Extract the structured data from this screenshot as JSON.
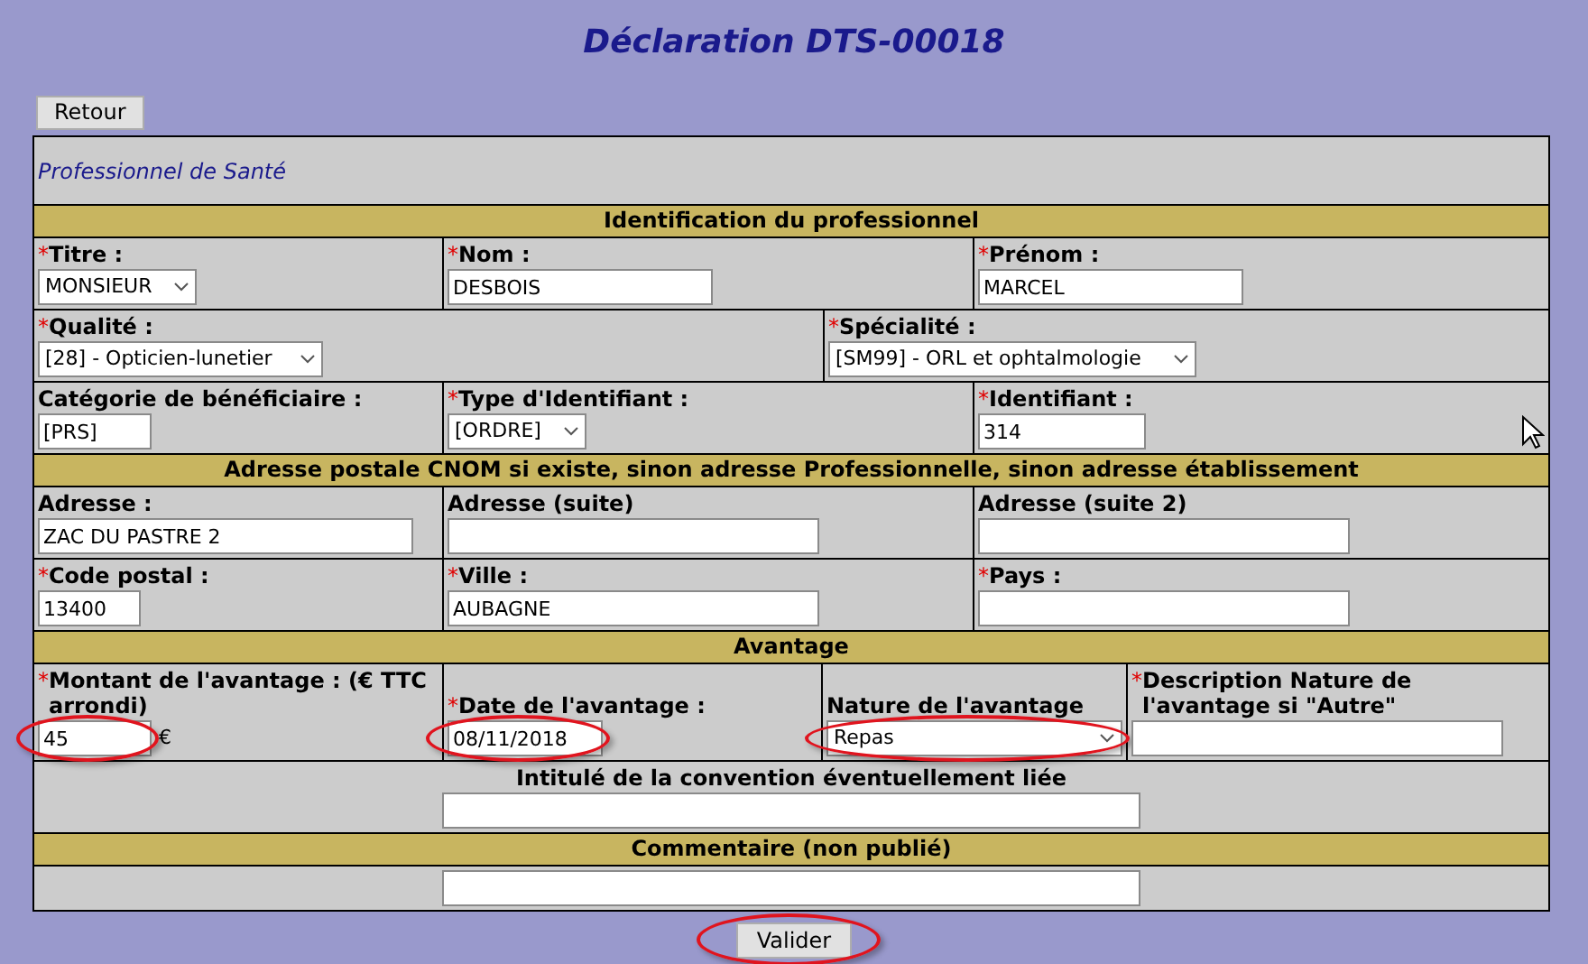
{
  "title": "Déclaration DTS-00018",
  "back_button": {
    "label": "Retour"
  },
  "sections": [
    {
      "kind": "caption",
      "label": "Professionnel de Santé"
    },
    {
      "kind": "header",
      "label": "Identification du professionnel"
    },
    {
      "kind": "fields",
      "fields": [
        {
          "required_mark": "*",
          "label": "Titre :",
          "kind": "select",
          "value": "MONSIEUR",
          "circled": false
        },
        {
          "required_mark": "*",
          "label": "Nom :",
          "kind": "text",
          "value": "DESBOIS",
          "circled": false
        },
        {
          "required_mark": "*",
          "label": "Prénom :",
          "kind": "text",
          "value": "MARCEL",
          "circled": false
        }
      ]
    },
    {
      "kind": "fields",
      "fields": [
        {
          "required_mark": "*",
          "label": "Qualité :",
          "kind": "select",
          "value": "[28] - Opticien-lunetier",
          "circled": false
        },
        {
          "required_mark": "*",
          "label": "Spécialité :",
          "kind": "select",
          "value": "[SM99] - ORL et ophtalmologie",
          "circled": false
        }
      ]
    },
    {
      "kind": "fields",
      "fields": [
        {
          "label": "Catégorie de bénéficiaire :",
          "kind": "text",
          "value": "[PRS]",
          "circled": false
        },
        {
          "required_mark": "*",
          "label": "Type d'Identifiant :",
          "kind": "select",
          "value": "[ORDRE]",
          "circled": false
        },
        {
          "required_mark": "*",
          "label": "Identifiant :",
          "kind": "text",
          "value": "314",
          "circled": false
        }
      ]
    },
    {
      "kind": "header",
      "label": "Adresse postale CNOM si existe, sinon adresse Professionnelle, sinon adresse établissement"
    },
    {
      "kind": "fields",
      "fields": [
        {
          "label": "Adresse :",
          "kind": "text",
          "value": "ZAC DU PASTRE 2",
          "circled": false
        },
        {
          "label": "Adresse (suite)",
          "kind": "text",
          "circled": false
        },
        {
          "label": "Adresse (suite 2)",
          "kind": "text",
          "circled": false
        }
      ]
    },
    {
      "kind": "fields",
      "fields": [
        {
          "required_mark": "*",
          "label": "Code postal :",
          "kind": "text",
          "value": "13400",
          "circled": false
        },
        {
          "required_mark": "*",
          "label": "Ville :",
          "kind": "text",
          "value": "AUBAGNE",
          "circled": false
        },
        {
          "required_mark": "*",
          "label": "Pays :",
          "kind": "text",
          "circled": false
        }
      ]
    },
    {
      "kind": "header",
      "label": "Avantage"
    },
    {
      "kind": "fields",
      "fields": [
        {
          "required_mark": "*",
          "label": "Montant de l'avantage : (€ TTC arrondi)",
          "kind": "text",
          "value": "45",
          "suffix": "€",
          "circled": true
        },
        {
          "required_mark": "*",
          "label": "Date de l'avantage :",
          "kind": "text",
          "value": "08/11/2018",
          "circled": true
        },
        {
          "label": "Nature de l'avantage",
          "kind": "select",
          "value": "Repas",
          "circled": true
        },
        {
          "required_mark": "*",
          "label": "Description Nature de l'avantage si \"Autre\"",
          "kind": "text",
          "circled": false
        }
      ]
    },
    {
      "kind": "fields",
      "fields": [
        {
          "label": "Intitulé de la convention éventuellement liée",
          "kind": "text",
          "circled": false
        }
      ]
    },
    {
      "kind": "header",
      "label": "Commentaire (non publié)"
    },
    {
      "kind": "fields",
      "fields": [
        {
          "kind": "text",
          "circled": false
        }
      ]
    }
  ],
  "submit_button": {
    "label": "Valider",
    "circled": true
  }
}
